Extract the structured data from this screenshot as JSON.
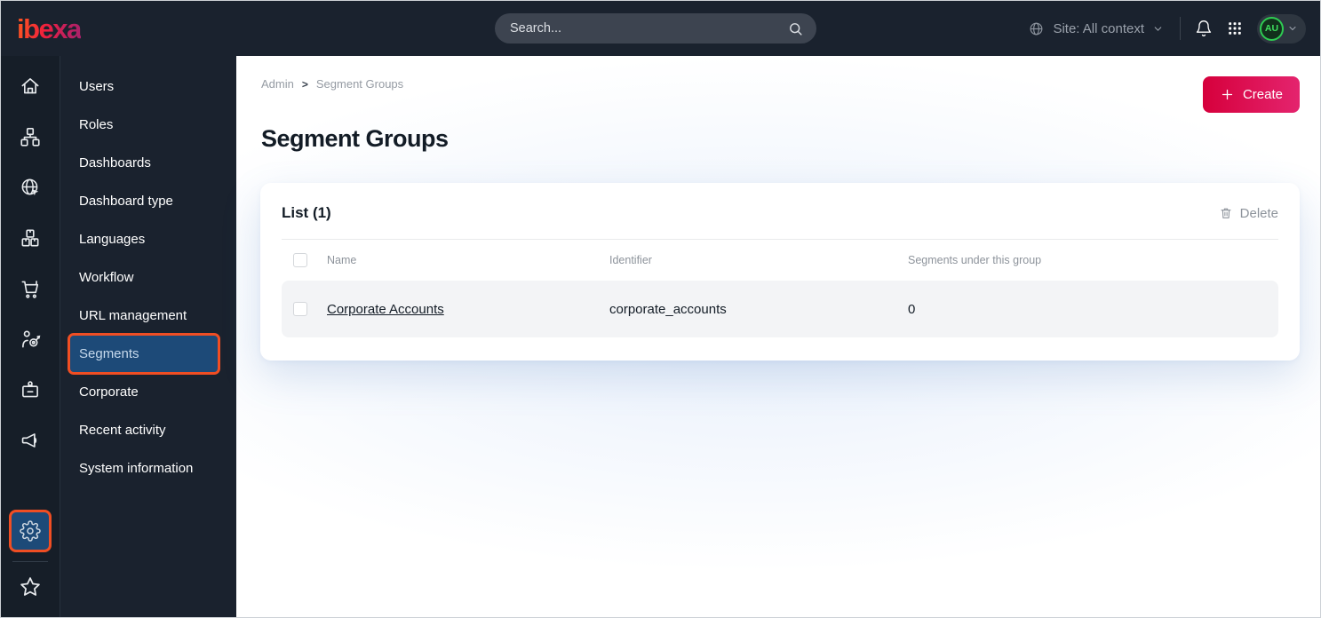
{
  "topbar": {
    "logo": "ibexa",
    "search_placeholder": "Search...",
    "site_context": "Site: All context",
    "avatar_initials": "AU"
  },
  "rail": {
    "items": [
      "home",
      "sitemap",
      "site-globe",
      "products",
      "commerce-cart",
      "personalization-target",
      "corporate-badge",
      "marketing-megaphone"
    ],
    "active_item": "admin-gear",
    "bottom_item": "bookmarks-star"
  },
  "menu": {
    "items": [
      {
        "label": "Users",
        "active": false
      },
      {
        "label": "Roles",
        "active": false
      },
      {
        "label": "Dashboards",
        "active": false
      },
      {
        "label": "Dashboard type",
        "active": false
      },
      {
        "label": "Languages",
        "active": false
      },
      {
        "label": "Workflow",
        "active": false
      },
      {
        "label": "URL management",
        "active": false
      },
      {
        "label": "Segments",
        "active": true
      },
      {
        "label": "Corporate",
        "active": false
      },
      {
        "label": "Recent activity",
        "active": false
      },
      {
        "label": "System information",
        "active": false
      }
    ]
  },
  "breadcrumb": {
    "items": [
      "Admin",
      "Segment Groups"
    ],
    "separator": ">"
  },
  "page": {
    "title": "Segment Groups"
  },
  "actions": {
    "create_label": "Create"
  },
  "list_card": {
    "title": "List (1)",
    "delete_label": "Delete",
    "table": {
      "headers": [
        "Name",
        "Identifier",
        "Segments under this group"
      ],
      "rows": [
        {
          "name": "Corporate Accounts",
          "identifier": "corporate_accounts",
          "segments_count": "0"
        }
      ]
    }
  },
  "colors": {
    "topbar_bg": "#1a222e",
    "rail_bg": "#161e28",
    "highlight_border_orange": "#f04e23",
    "active_blue": "#1d4a78",
    "create_gradient_start": "#d6003c",
    "create_gradient_end": "#e4246e",
    "avatar_green": "#2ecc52",
    "content_glow": "#e7effb"
  }
}
